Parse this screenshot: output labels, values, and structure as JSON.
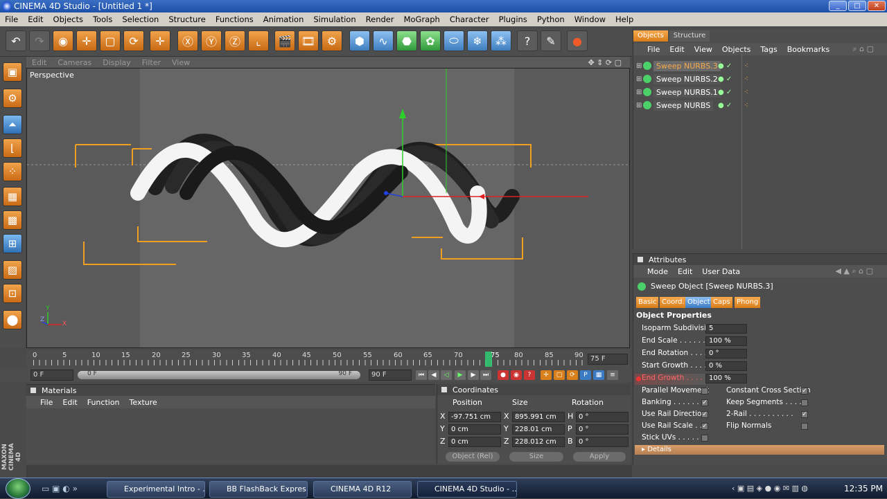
{
  "window": {
    "title": "CINEMA 4D Studio - [Untitled 1 *]"
  },
  "menubar": [
    "File",
    "Edit",
    "Objects",
    "Tools",
    "Selection",
    "Structure",
    "Functions",
    "Animation",
    "Simulation",
    "Render",
    "MoGraph",
    "Character",
    "Plugins",
    "Python",
    "Window",
    "Help"
  ],
  "viewport": {
    "menu": [
      "Edit",
      "Cameras",
      "Display",
      "Filter",
      "View"
    ],
    "label": "Perspective",
    "axis_labels": {
      "y": "Y",
      "z": "Z",
      "x": "X"
    }
  },
  "timeline": {
    "ticks": [
      "0",
      "5",
      "10",
      "15",
      "20",
      "25",
      "30",
      "35",
      "40",
      "45",
      "50",
      "55",
      "60",
      "65",
      "70",
      "75",
      "80",
      "85",
      "90"
    ],
    "current_frame_marker": "75",
    "current_frame_field": "75 F",
    "start_field": "0 F",
    "range_start": "0 F",
    "range_end": "90 F",
    "end_field": "90 F"
  },
  "materials": {
    "title": "Materials",
    "menu": [
      "File",
      "Edit",
      "Function",
      "Texture"
    ]
  },
  "coordinates": {
    "title": "Coordinates",
    "headers": [
      "Position",
      "Size",
      "Rotation"
    ],
    "rows": [
      {
        "axis": "X",
        "pos": "-97.751 cm",
        "size_axis": "X",
        "size": "895.991 cm",
        "rot_axis": "H",
        "rot": "0 °"
      },
      {
        "axis": "Y",
        "pos": "0 cm",
        "size_axis": "Y",
        "size": "228.01 cm",
        "rot_axis": "P",
        "rot": "0 °"
      },
      {
        "axis": "Z",
        "pos": "0 cm",
        "size_axis": "Z",
        "size": "228.012 cm",
        "rot_axis": "B",
        "rot": "0 °"
      }
    ],
    "mode_dropdown": "Object (Rel)",
    "size_dropdown": "Size",
    "apply": "Apply"
  },
  "object_manager": {
    "tabs": [
      "Objects",
      "Structure"
    ],
    "menu": [
      "File",
      "Edit",
      "View",
      "Objects",
      "Tags",
      "Bookmarks"
    ],
    "objects": [
      "Sweep NURBS.3",
      "Sweep NURBS.2",
      "Sweep NURBS.1",
      "Sweep NURBS"
    ]
  },
  "attributes": {
    "title": "Attributes",
    "menu": [
      "Mode",
      "Edit",
      "User Data"
    ],
    "object_title": "Sweep Object [Sweep NURBS.3]",
    "tabs": [
      "Basic",
      "Coord.",
      "Object",
      "Caps",
      "Phong"
    ],
    "section": "Object Properties",
    "fields": [
      {
        "label": "Isoparm Subdivision",
        "value": "5"
      },
      {
        "label": "End Scale . . . . . .",
        "value": "100 %"
      },
      {
        "label": "End Rotation . . . .",
        "value": "0 °"
      },
      {
        "label": "Start Growth . . . .",
        "value": "0 %"
      },
      {
        "label": "End Growth . . . . .",
        "value": "100 %"
      }
    ],
    "checks_left": [
      {
        "label": "Parallel Movement",
        "checked": false
      },
      {
        "label": "Banking . . . . . . . .",
        "checked": true
      },
      {
        "label": "Use Rail Direction",
        "checked": true
      },
      {
        "label": "Use Rail Scale . . .",
        "checked": true
      },
      {
        "label": "Stick UVs . . . . . .",
        "checked": false
      }
    ],
    "checks_right": [
      {
        "label": "Constant Cross Section",
        "checked": true
      },
      {
        "label": "Keep Segments . . . .",
        "checked": false
      },
      {
        "label": "2-Rail . . . . . . . . . .",
        "checked": true
      },
      {
        "label": "Flip Normals",
        "checked": false
      }
    ],
    "details": "Details"
  },
  "sidebar_brand": "MAXON CINEMA 4D",
  "taskbar": {
    "items": [
      "Experimental Intro - ...",
      "BB FlashBack Expres...",
      "CINEMA 4D R12",
      "CINEMA 4D Studio - ..."
    ],
    "clock": "12:35 PM"
  }
}
